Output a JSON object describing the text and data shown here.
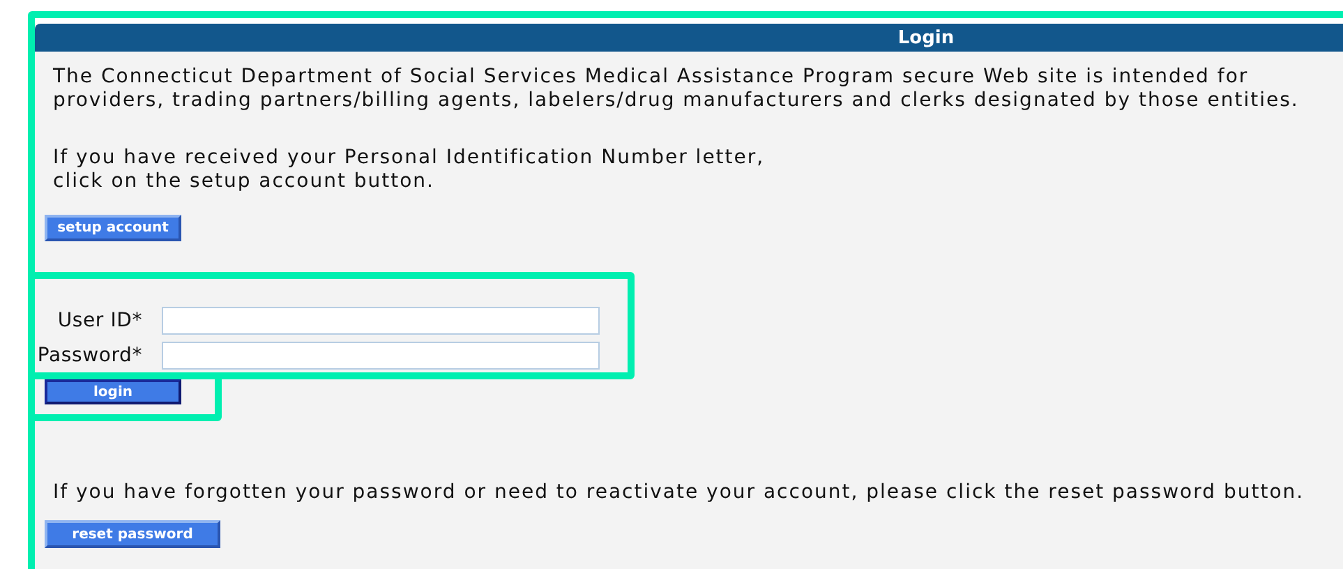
{
  "panel": {
    "title": "Login"
  },
  "intro": "The Connecticut Department of Social Services Medical Assistance Program secure Web site is intended for providers, trading partners/billing agents, labelers/drug manufacturers and clerks designated by those entities.",
  "pin_note": [
    "If you have received your Personal Identification Number letter,",
    "click on the setup account button."
  ],
  "setup_button": "setup account",
  "fields": [
    {
      "label": "User ID*"
    },
    {
      "label": "Password*"
    }
  ],
  "login_button": "login",
  "reset_note": "If you have forgotten your password or need to reactivate your account, please click the reset password button.",
  "reset_button": "reset password"
}
